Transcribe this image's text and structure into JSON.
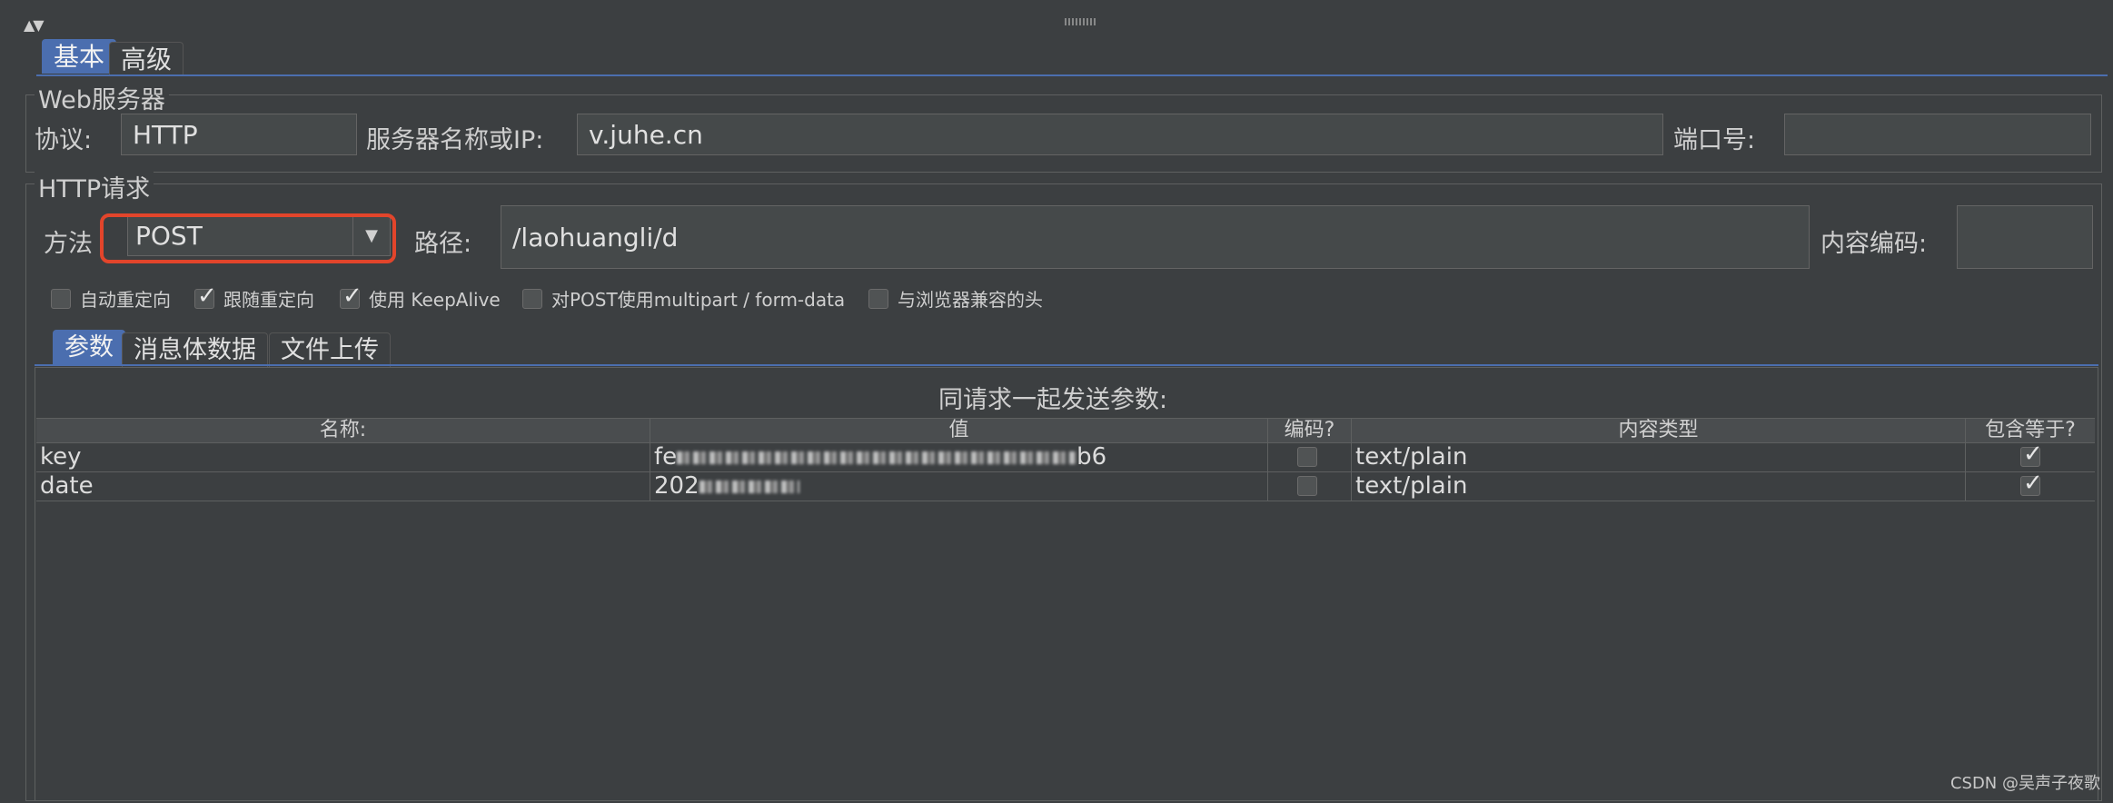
{
  "tabs": [
    {
      "label": "基本",
      "active": true
    },
    {
      "label": "高级",
      "active": false
    }
  ],
  "web_server": {
    "title": "Web服务器",
    "protocol_label": "协议:",
    "protocol_value": "HTTP",
    "server_label": "服务器名称或IP:",
    "server_value": "v.juhe.cn",
    "port_label": "端口号:",
    "port_value": ""
  },
  "http_request": {
    "title": "HTTP请求",
    "method_label": "方法",
    "method_value": "POST",
    "path_label": "路径:",
    "path_value": "/laohuangli/d",
    "encoding_label": "内容编码:",
    "encoding_value": "",
    "options": [
      {
        "label": "自动重定向",
        "checked": false
      },
      {
        "label": "跟随重定向",
        "checked": true
      },
      {
        "label": "使用 KeepAlive",
        "checked": true
      },
      {
        "label": "对POST使用multipart / form-data",
        "checked": false
      },
      {
        "label": "与浏览器兼容的头",
        "checked": false
      }
    ]
  },
  "sub_tabs": [
    {
      "label": "参数",
      "active": true
    },
    {
      "label": "消息体数据",
      "active": false
    },
    {
      "label": "文件上传",
      "active": false
    }
  ],
  "params": {
    "title": "同请求一起发送参数:",
    "columns": [
      "名称:",
      "值",
      "编码?",
      "内容类型",
      "包含等于?"
    ],
    "rows": [
      {
        "name": "key",
        "value_visible": "fe",
        "value_tail": "b6",
        "encode": false,
        "content_type": "text/plain",
        "include_equals": true
      },
      {
        "name": "date",
        "value_visible": "202",
        "value_tail": "",
        "encode": false,
        "content_type": "text/plain",
        "include_equals": true
      }
    ]
  },
  "watermark": "CSDN @吴声子夜歌",
  "colors": {
    "accent": "#4b6eaf",
    "highlight": "#e2452b",
    "background": "#3c3f41"
  }
}
